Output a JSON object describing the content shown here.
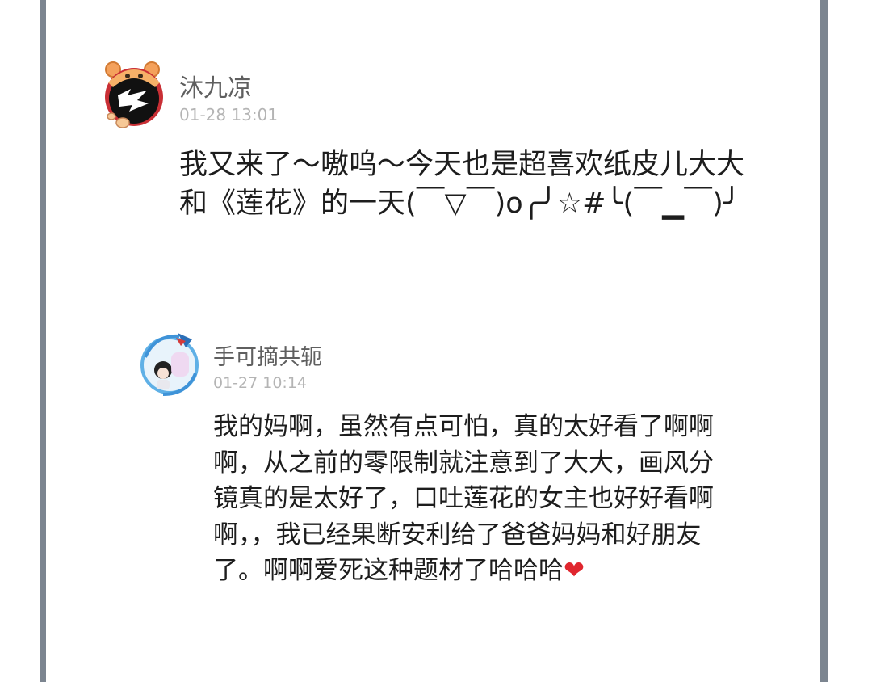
{
  "comments": [
    {
      "username": "沐九凉",
      "timestamp": "01-28 13:01",
      "text": "我又来了～嗷呜～今天也是超喜欢纸皮儿大大和《莲花》的一天(￣▽￣)o╭╯☆#╰(￣▁￣)╯"
    }
  ],
  "reply": {
    "username": "手可摘共轭",
    "timestamp": "01-27 10:14",
    "text": "我的妈啊，虽然有点可怕，真的太好看了啊啊啊，从之前的零限制就注意到了大大，画风分镜真的是太好了，口吐莲花的女主也好好看啊啊，，我已经果断安利给了爸爸妈妈和好朋友了。啊啊爱死这种题材了哈哈哈",
    "emoji": "❤"
  },
  "colors": {
    "border": "#7c8590",
    "username": "#5f5f5f",
    "timestamp": "#b4b4b4",
    "text": "#1d1d1d",
    "heart": "#e0262e"
  }
}
